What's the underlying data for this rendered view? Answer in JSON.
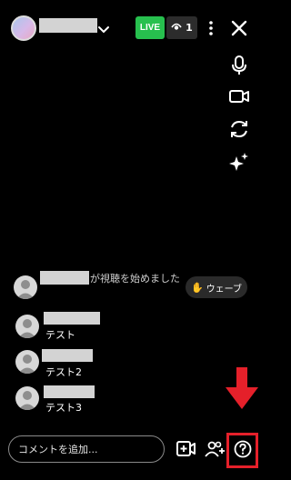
{
  "header": {
    "live_label": "LIVE",
    "viewer_count": "1",
    "live_color": "#27c04e"
  },
  "icons": {
    "top": [
      "chevron-down-icon",
      "eye-icon",
      "more-vertical-icon",
      "close-icon"
    ],
    "side": [
      "microphone-icon",
      "video-camera-icon",
      "flip-camera-icon",
      "effects-sparkle-icon"
    ],
    "bottom": [
      "add-video-guest-icon",
      "add-person-icon",
      "help-icon"
    ]
  },
  "comments": {
    "join_message": "が視聴を始めました",
    "items": [
      {
        "text": "テスト"
      },
      {
        "text": "テスト2"
      },
      {
        "text": "テスト3"
      }
    ]
  },
  "wave_button": {
    "label": "ウェーブ"
  },
  "comment_input": {
    "placeholder": "コメントを追加..."
  },
  "annotation": {
    "arrow_color": "#e5202a"
  }
}
